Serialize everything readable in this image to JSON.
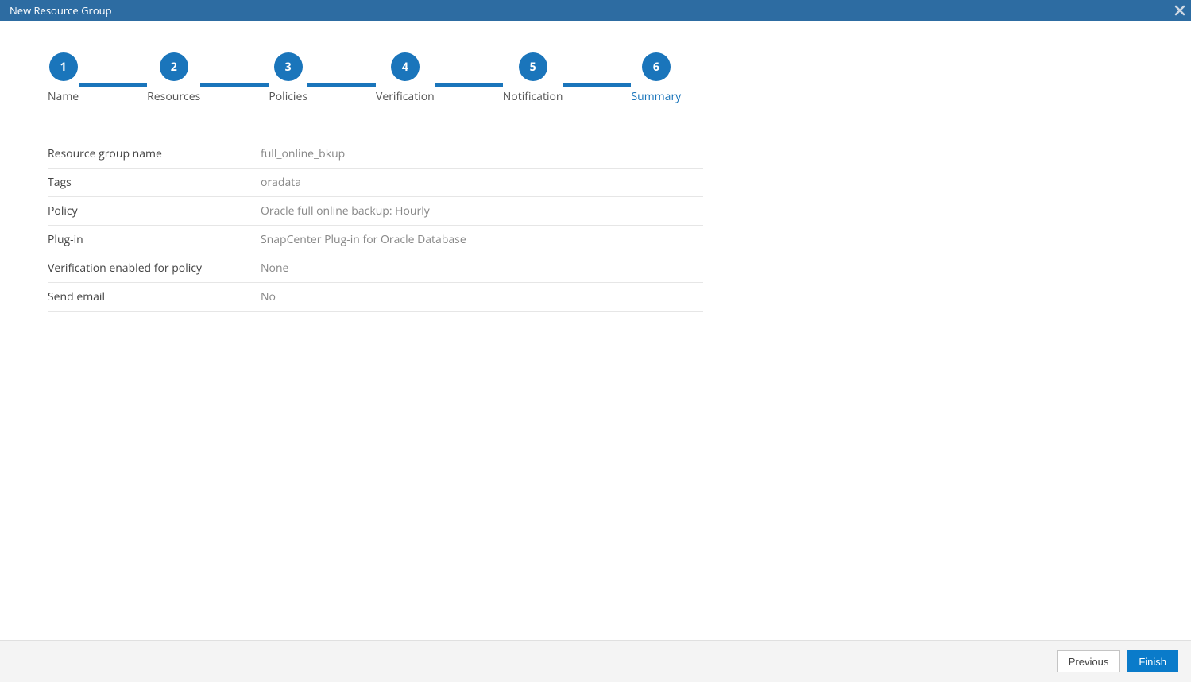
{
  "window": {
    "title": "New Resource Group"
  },
  "stepper": {
    "steps": [
      {
        "num": "1",
        "label": "Name"
      },
      {
        "num": "2",
        "label": "Resources"
      },
      {
        "num": "3",
        "label": "Policies"
      },
      {
        "num": "4",
        "label": "Verification"
      },
      {
        "num": "5",
        "label": "Notification"
      },
      {
        "num": "6",
        "label": "Summary"
      }
    ],
    "activeIndex": 5
  },
  "summary": {
    "rows": [
      {
        "key": "Resource group name",
        "val": "full_online_bkup"
      },
      {
        "key": "Tags",
        "val": "oradata"
      },
      {
        "key": "Policy",
        "val": "Oracle full online backup: Hourly"
      },
      {
        "key": "Plug-in",
        "val": "SnapCenter Plug-in for Oracle Database"
      },
      {
        "key": "Verification enabled for policy",
        "val": "None"
      },
      {
        "key": "Send email",
        "val": "No"
      }
    ]
  },
  "footer": {
    "previous": "Previous",
    "finish": "Finish"
  }
}
